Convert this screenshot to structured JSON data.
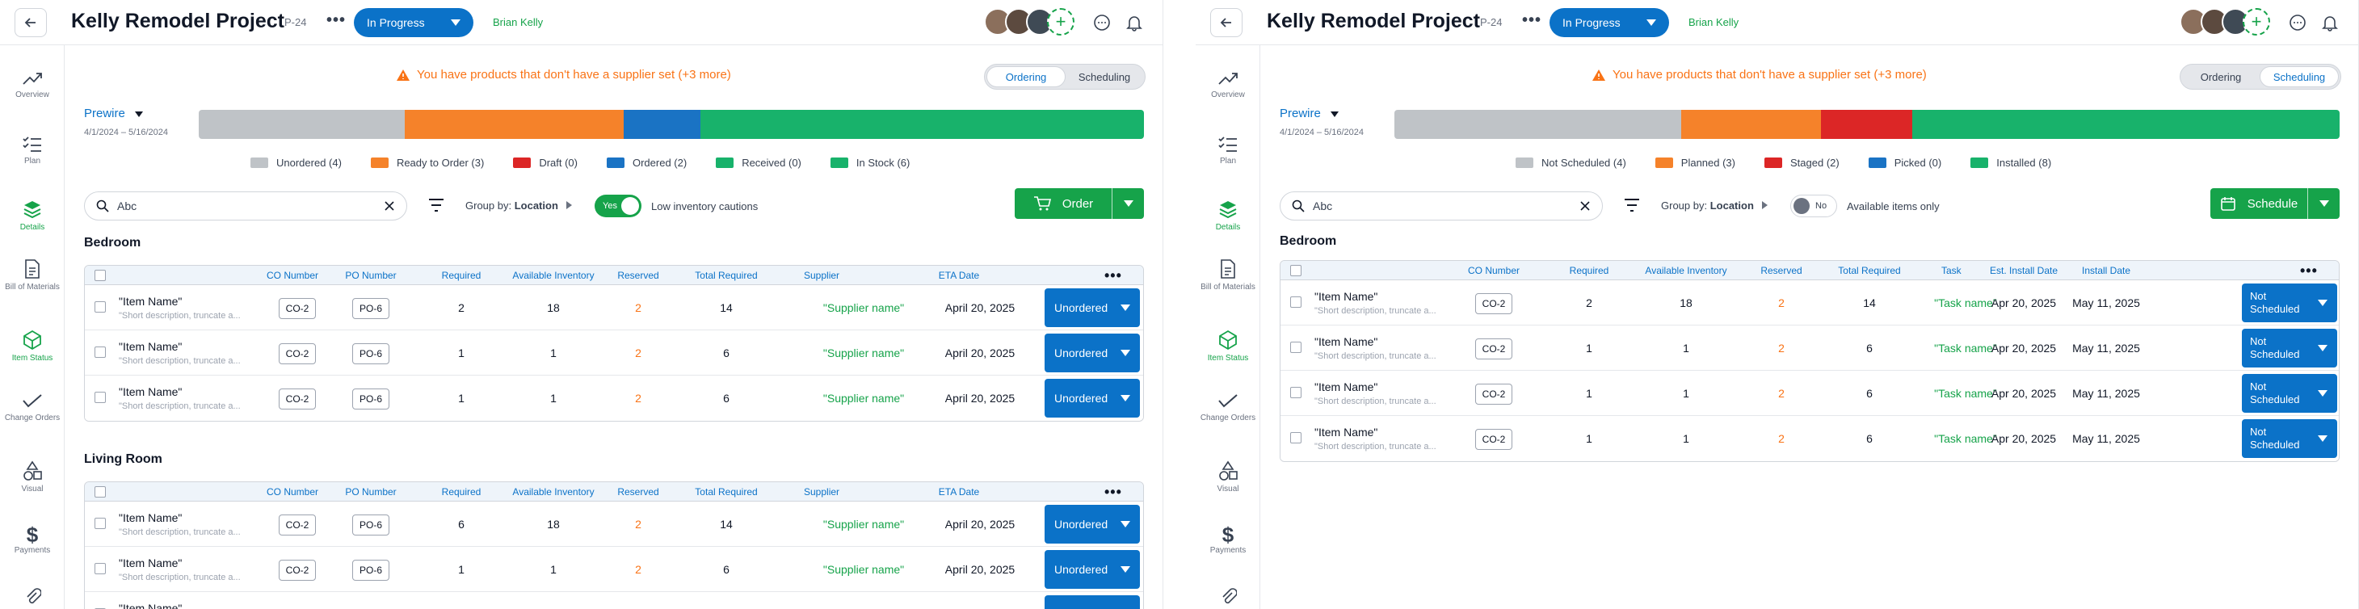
{
  "project": {
    "title": "Kelly Remodel Project",
    "code": "P-24",
    "more": "•••",
    "status": "In Progress",
    "owner": "Brian Kelly"
  },
  "sidebar": {
    "items": [
      {
        "label": "Overview",
        "icon": "trend-icon"
      },
      {
        "label": "Plan",
        "icon": "checklist-icon"
      },
      {
        "label": "Details",
        "icon": "layers-icon"
      },
      {
        "label": "Bill of Materials",
        "icon": "document-icon"
      },
      {
        "label": "Item Status",
        "icon": "cube-icon"
      },
      {
        "label": "Change Orders",
        "icon": "check-pencil-icon"
      },
      {
        "label": "Visual",
        "icon": "shapes-icon"
      },
      {
        "label": "Payments",
        "icon": "dollar-icon"
      },
      {
        "label": "",
        "icon": "paperclip-icon"
      }
    ]
  },
  "warning": "You have products that don't have a supplier set (+3 more)",
  "view_toggle": {
    "ordering": "Ordering",
    "scheduling": "Scheduling"
  },
  "phase": {
    "name": "Prewire",
    "dates": "4/1/2024 – 5/16/2024"
  },
  "colors": {
    "blue": "#0b72c8",
    "green": "#16a34a",
    "orange": "#f97316",
    "gray": "#bfc3c7",
    "red": "#dc2626",
    "bar_orange": "#f5822a",
    "bar_blue": "#1a73c4",
    "bar_green": "#18b26b"
  },
  "search": {
    "value": "Abc"
  },
  "group_by": {
    "label": "Group by:",
    "value": "Location"
  },
  "ordering": {
    "progress": [
      {
        "status": "Unordered",
        "fraction": 0.218,
        "color": "#bfc3c7"
      },
      {
        "status": "Ready to Order",
        "fraction": 0.232,
        "color": "#f5822a"
      },
      {
        "status": "Ordered",
        "fraction": 0.081,
        "color": "#1a73c4"
      },
      {
        "status": "In Stock",
        "fraction": 0.469,
        "color": "#18b26b"
      }
    ],
    "legend": [
      {
        "label": "Unordered (4)",
        "color": "#bfc3c7"
      },
      {
        "label": "Ready to Order (3)",
        "color": "#f5822a"
      },
      {
        "label": "Draft (0)",
        "color": "#dc2626"
      },
      {
        "label": "Ordered (2)",
        "color": "#1a73c4"
      },
      {
        "label": "Received (0)",
        "color": "#18b26b"
      },
      {
        "label": "In Stock (6)",
        "color": "#18b26b"
      }
    ],
    "toggle": {
      "state": "Yes",
      "label": "Low inventory cautions"
    },
    "action": "Order",
    "columns": [
      "CO Number",
      "PO Number",
      "Required",
      "Available Inventory",
      "Reserved",
      "Total Required",
      "Supplier",
      "ETA Date"
    ],
    "sections": [
      {
        "title": "Bedroom",
        "rows": [
          {
            "name": "\"Item Name\"",
            "desc": "\"Short description, truncate a...",
            "co": "CO-2",
            "po": "PO-6",
            "required": "2",
            "available": "18",
            "reserved": "2",
            "total": "14",
            "supplier": "\"Supplier name\"",
            "eta": "April 20, 2025",
            "status": "Unordered"
          },
          {
            "name": "\"Item Name\"",
            "desc": "\"Short description, truncate a...",
            "co": "CO-2",
            "po": "PO-6",
            "required": "1",
            "available": "1",
            "reserved": "2",
            "total": "6",
            "supplier": "\"Supplier name\"",
            "eta": "April 20, 2025",
            "status": "Unordered"
          },
          {
            "name": "\"Item Name\"",
            "desc": "\"Short description, truncate a...",
            "co": "CO-2",
            "po": "PO-6",
            "required": "1",
            "available": "1",
            "reserved": "2",
            "total": "6",
            "supplier": "\"Supplier name\"",
            "eta": "April 20, 2025",
            "status": "Unordered"
          }
        ]
      },
      {
        "title": "Living Room",
        "rows": [
          {
            "name": "\"Item Name\"",
            "desc": "\"Short description, truncate a...",
            "co": "CO-2",
            "po": "PO-6",
            "required": "6",
            "available": "18",
            "reserved": "2",
            "total": "14",
            "supplier": "\"Supplier name\"",
            "eta": "April 20, 2025",
            "status": "Unordered"
          },
          {
            "name": "\"Item Name\"",
            "desc": "\"Short description, truncate a...",
            "co": "CO-2",
            "po": "PO-6",
            "required": "1",
            "available": "1",
            "reserved": "2",
            "total": "6",
            "supplier": "\"Supplier name\"",
            "eta": "April 20, 2025",
            "status": "Unordered"
          },
          {
            "name": "\"Item Name\"",
            "desc": "",
            "co": "",
            "po": "",
            "required": "",
            "available": "",
            "reserved": "",
            "total": "",
            "supplier": "",
            "eta": "",
            "status": ""
          }
        ]
      }
    ]
  },
  "scheduling": {
    "progress": [
      {
        "status": "Not Scheduled",
        "fraction": 0.303,
        "color": "#bfc3c7"
      },
      {
        "status": "Planned",
        "fraction": 0.148,
        "color": "#f5822a"
      },
      {
        "status": "Staged",
        "fraction": 0.097,
        "color": "#dc2626"
      },
      {
        "status": "Installed",
        "fraction": 0.452,
        "color": "#18b26b"
      }
    ],
    "legend": [
      {
        "label": "Not Scheduled (4)",
        "color": "#bfc3c7"
      },
      {
        "label": "Planned (3)",
        "color": "#f5822a"
      },
      {
        "label": "Staged (2)",
        "color": "#dc2626"
      },
      {
        "label": "Picked (0)",
        "color": "#1a73c4"
      },
      {
        "label": "Installed (8)",
        "color": "#18b26b"
      }
    ],
    "toggle": {
      "state": "No",
      "label": "Available items only"
    },
    "action": "Schedule",
    "columns": [
      "CO Number",
      "Required",
      "Available Inventory",
      "Reserved",
      "Total Required",
      "Task",
      "Est. Install Date",
      "Install Date"
    ],
    "sections": [
      {
        "title": "Bedroom",
        "rows": [
          {
            "name": "\"Item Name\"",
            "desc": "\"Short description, truncate a...",
            "co": "CO-2",
            "required": "2",
            "available": "18",
            "reserved": "2",
            "total": "14",
            "task": "\"Task name\"",
            "est": "Apr 20, 2025",
            "install": "May 11, 2025",
            "status": "Not Scheduled"
          },
          {
            "name": "\"Item Name\"",
            "desc": "\"Short description, truncate a...",
            "co": "CO-2",
            "required": "1",
            "available": "1",
            "reserved": "2",
            "total": "6",
            "task": "\"Task name\"",
            "est": "Apr 20, 2025",
            "install": "May 11, 2025",
            "status": "Not Scheduled"
          },
          {
            "name": "\"Item Name\"",
            "desc": "\"Short description, truncate a...",
            "co": "CO-2",
            "required": "1",
            "available": "1",
            "reserved": "2",
            "total": "6",
            "task": "\"Task name\"",
            "est": "Apr 20, 2025",
            "install": "May 11, 2025",
            "status": "Not Scheduled"
          },
          {
            "name": "\"Item Name\"",
            "desc": "\"Short description, truncate a...",
            "co": "CO-2",
            "required": "1",
            "available": "1",
            "reserved": "2",
            "total": "6",
            "task": "\"Task name\"",
            "est": "Apr 20, 2025",
            "install": "May 11, 2025",
            "status": "Not Scheduled"
          }
        ]
      }
    ]
  }
}
